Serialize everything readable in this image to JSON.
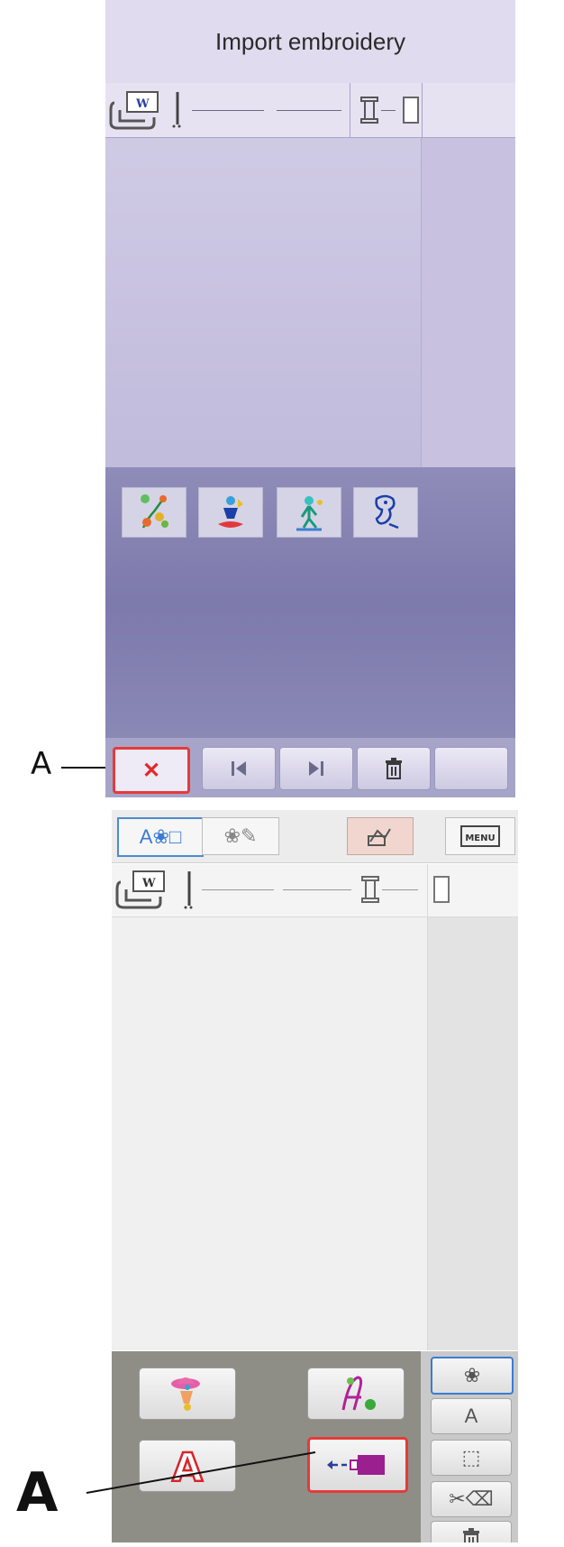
{
  "callouts": {
    "top_label": "A",
    "bottom_label": "A"
  },
  "screen1": {
    "title": "Import embroidery",
    "hoop_icon_letter": "W",
    "thumbnails": [
      "flower-bouquet-icon",
      "boy-sailing-icon",
      "child-playing-icon",
      "dog-figure-icon"
    ],
    "bottom_buttons": [
      {
        "name": "cancel",
        "icon": "close-icon",
        "glyph": "✕"
      },
      {
        "name": "previous",
        "icon": "skip-previous-icon",
        "glyph": "⏮"
      },
      {
        "name": "next",
        "icon": "skip-next-icon",
        "glyph": "⏭"
      },
      {
        "name": "delete",
        "icon": "trash-icon",
        "glyph": "🗑"
      },
      {
        "name": "blank",
        "icon": "",
        "glyph": ""
      }
    ]
  },
  "screen2": {
    "tabs": [
      {
        "name": "edit",
        "glyph": "A❀□"
      },
      {
        "name": "stitch",
        "glyph": "❀✎"
      },
      {
        "name": "embroider",
        "glyph": "⎋"
      },
      {
        "name": "menu",
        "glyph": "MENU"
      }
    ],
    "hoop_icon_letter": "W",
    "load_buttons": [
      {
        "name": "load-design",
        "icon": "design-icon"
      },
      {
        "name": "load-font",
        "icon": "font-design-icon"
      },
      {
        "name": "load-text",
        "icon": "text-a-icon",
        "glyph": "A"
      },
      {
        "name": "import",
        "icon": "import-arrow-icon"
      }
    ],
    "side_buttons": [
      {
        "name": "design",
        "glyph": "❀"
      },
      {
        "name": "text",
        "glyph": "A"
      },
      {
        "name": "hoop",
        "glyph": "⬚"
      },
      {
        "name": "edit-stitches",
        "glyph": "✂⌫"
      },
      {
        "name": "delete",
        "glyph": "🗑"
      }
    ]
  },
  "colors": {
    "highlight_red": "#e53a3a",
    "selected_blue": "#4c8bd0",
    "magenta": "#9b1f8e"
  }
}
